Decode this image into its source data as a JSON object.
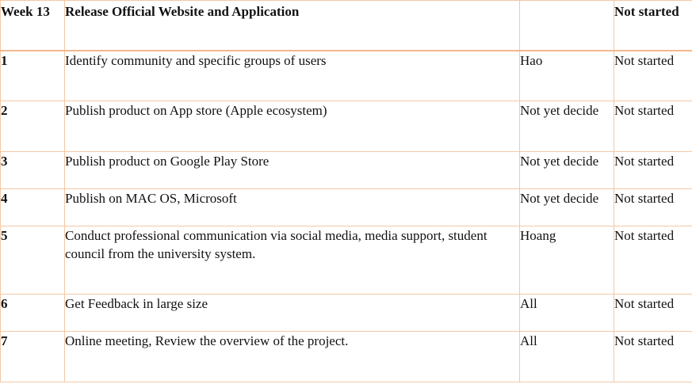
{
  "header": {
    "week": "Week 13",
    "title": "Release Official Website and Application",
    "owner": "",
    "status": "Not started"
  },
  "rows": [
    {
      "num": "1",
      "task": "Identify community and specific groups of users",
      "owner": "Hao",
      "status": "Not started"
    },
    {
      "num": "2",
      "task": "Publish product on App store (Apple ecosystem)",
      "owner": "Not yet decide",
      "status": "Not started"
    },
    {
      "num": "3",
      "task": "Publish product on Google Play Store",
      "owner": "Not yet decide",
      "status": "Not started"
    },
    {
      "num": "4",
      "task": "Publish on MAC OS, Microsoft",
      "owner": "Not yet decide",
      "status": "Not started"
    },
    {
      "num": "5",
      "task": "Conduct professional communication via social media, media support, student council from the university system.",
      "owner": "Hoang",
      "status": "Not started"
    },
    {
      "num": "6",
      "task": "Get Feedback in large size",
      "owner": "All",
      "status": "Not started"
    },
    {
      "num": "7",
      "task": "Online meeting, Review the overview of the project.",
      "owner": "All",
      "status": "Not started"
    }
  ]
}
